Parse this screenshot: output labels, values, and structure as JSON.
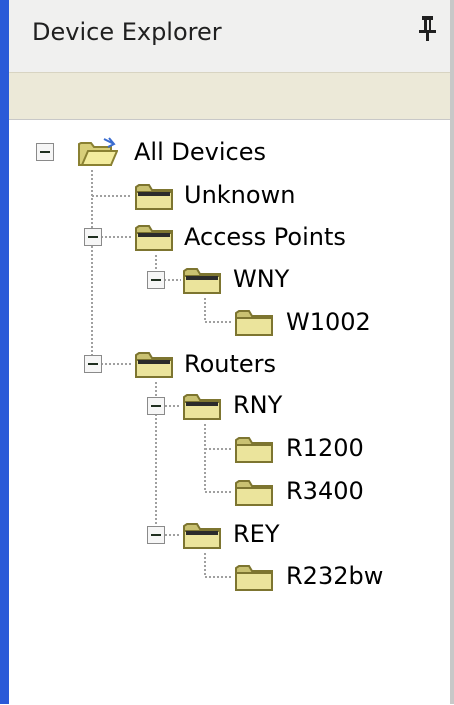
{
  "panel": {
    "title": "Device Explorer",
    "pin_icon": "pushpin-icon"
  },
  "colors": {
    "left_border": "#2a5ad8",
    "title_bar": "#f0f0ef",
    "toolbar": "#ece9d8",
    "folder_fill": "#e8e29a",
    "folder_outline": "#8a8132",
    "tree_lines": "#a0a0a0"
  },
  "tree": {
    "root": {
      "label": "All Devices",
      "icon": "open-folder-icon",
      "expanded": true
    },
    "unknown": {
      "label": "Unknown",
      "icon": "folder-icon"
    },
    "access_points": {
      "label": "Access Points",
      "icon": "folder-icon",
      "expanded": true,
      "wny": {
        "label": "WNY",
        "icon": "folder-icon",
        "expanded": true,
        "w1002": {
          "label": "W1002",
          "icon": "folder-icon"
        }
      }
    },
    "routers": {
      "label": "Routers",
      "icon": "folder-icon",
      "expanded": true,
      "rny": {
        "label": "RNY",
        "icon": "folder-icon",
        "expanded": true,
        "r1200": {
          "label": "R1200",
          "icon": "folder-icon"
        },
        "r3400": {
          "label": "R3400",
          "icon": "folder-icon"
        }
      },
      "rey": {
        "label": "REY",
        "icon": "folder-icon",
        "expanded": true,
        "r232bw": {
          "label": "R232bw",
          "icon": "folder-icon"
        }
      }
    }
  }
}
